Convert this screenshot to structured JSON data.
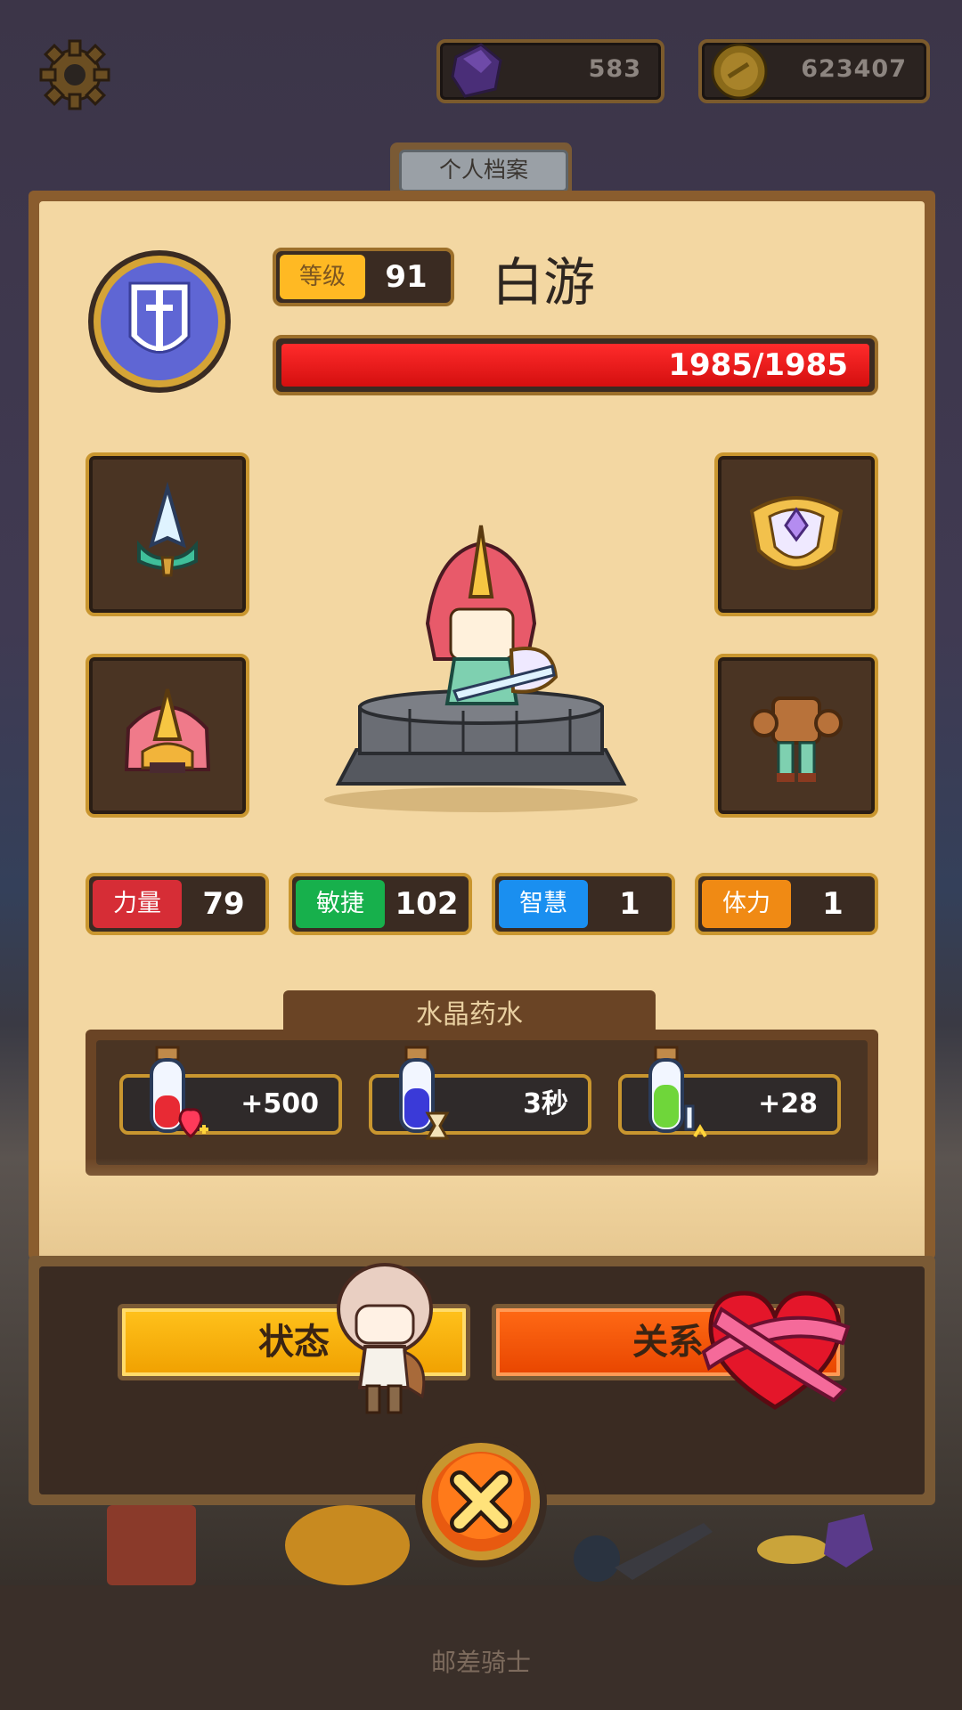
{
  "top_bar": {
    "gems": "583",
    "coins": "623407"
  },
  "profile_tab": "个人档案",
  "player": {
    "level_label": "等级",
    "level": "91",
    "name": "白游",
    "hp_text": "1985/1985",
    "hp_fraction": 1.0
  },
  "stats": [
    {
      "label": "力量",
      "value": "79",
      "color": "#d62d36"
    },
    {
      "label": "敏捷",
      "value": "102",
      "color": "#17b04c"
    },
    {
      "label": "智慧",
      "value": "1",
      "color": "#1a8ff0"
    },
    {
      "label": "体力",
      "value": "1",
      "color": "#f08a14"
    }
  ],
  "potions": {
    "title": "水晶药水",
    "items": [
      {
        "value": "+500",
        "icon": "red-potion-heart-icon"
      },
      {
        "value": "3秒",
        "icon": "blue-potion-hourglass-icon"
      },
      {
        "value": "+28",
        "icon": "green-potion-sword-icon"
      }
    ]
  },
  "buttons": {
    "status": "状态",
    "relation": "关系"
  },
  "footer_title": "邮差骑士",
  "colors": {
    "panel": "#f3d7a2",
    "frame": "#8a5d2e",
    "hp": "#e51b1b",
    "gold_border": "#c9962f"
  }
}
